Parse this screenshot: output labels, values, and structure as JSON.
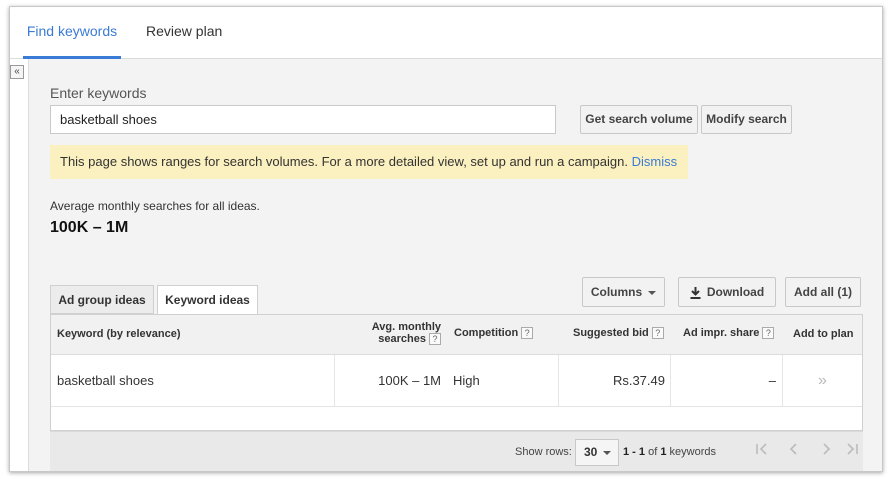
{
  "tabs": {
    "find": "Find keywords",
    "review": "Review plan"
  },
  "collapse_glyph": "«",
  "search": {
    "label": "Enter keywords",
    "value": "basketball shoes",
    "get_volume": "Get search volume",
    "modify": "Modify search"
  },
  "notice": {
    "text": "This page shows ranges for search volumes. For a more detailed view, set up and run a campaign.",
    "dismiss": "Dismiss"
  },
  "summary": {
    "label": "Average monthly searches for all ideas.",
    "value": "100K – 1M"
  },
  "subtabs": {
    "adgroup": "Ad group ideas",
    "keyword": "Keyword ideas"
  },
  "actions": {
    "columns": "Columns",
    "download": "Download",
    "add_all": "Add all (1)"
  },
  "table": {
    "headers": {
      "keyword": "Keyword (by relevance)",
      "avg_line1": "Avg. monthly",
      "avg_line2": "searches",
      "competition": "Competition",
      "bid": "Suggested bid",
      "impr": "Ad impr. share",
      "add": "Add to plan"
    },
    "help_glyph": "?",
    "rows": [
      {
        "keyword": "basketball shoes",
        "avg": "100K – 1M",
        "competition": "High",
        "bid": "Rs.37.49",
        "impr": "–",
        "add": "»"
      }
    ]
  },
  "footer": {
    "show_rows": "Show rows:",
    "rows_value": "30",
    "range": "1 - 1",
    "of": "of",
    "total": "1",
    "unit": "keywords"
  },
  "colors": {
    "accent": "#3a7bd5",
    "notice_bg": "#fbf0bf"
  }
}
